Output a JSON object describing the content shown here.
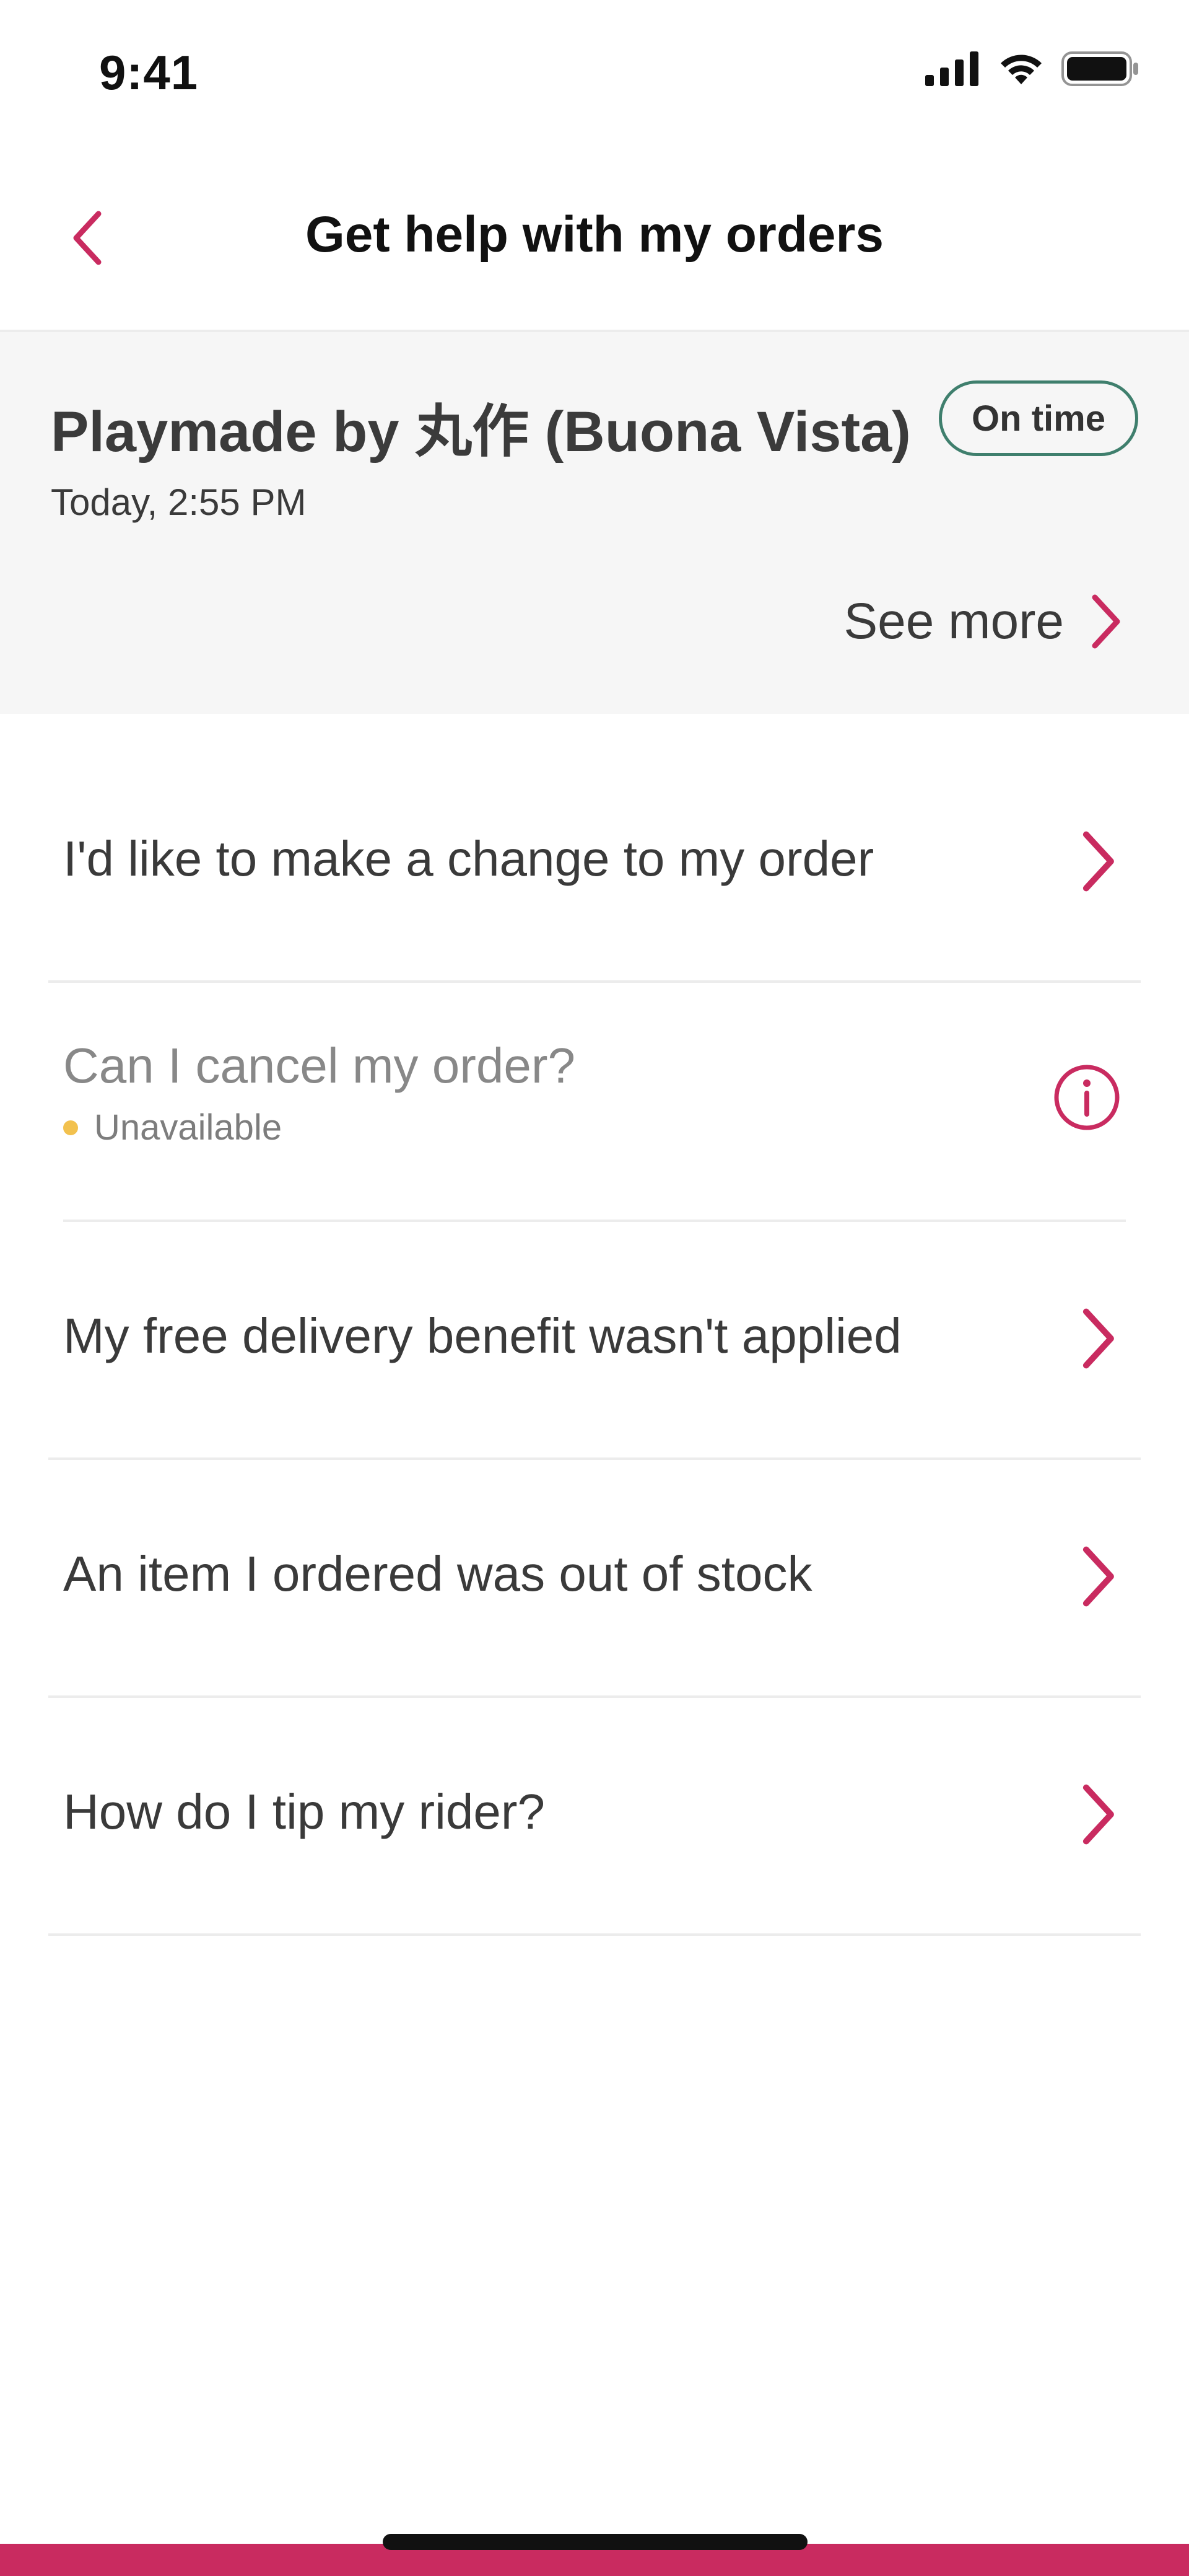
{
  "status_bar": {
    "time": "9:41",
    "icons": [
      "signal-icon",
      "wifi-icon",
      "battery-icon"
    ]
  },
  "nav": {
    "title": "Get help with my orders",
    "back_icon": "chevron-left-icon"
  },
  "order": {
    "restaurant": "Playmade by 丸作 (Buona Vista)",
    "status": "On time",
    "time": "Today, 2:55 PM",
    "see_more": "See more"
  },
  "help_items": [
    {
      "label": "I'd like to make a change to my order",
      "icon": "chevron-right-icon"
    },
    {
      "label": "Can I cancel my order?",
      "sublabel": "Unavailable",
      "icon": "info-icon",
      "disabled": true
    },
    {
      "label": "My free delivery benefit wasn't applied",
      "icon": "chevron-right-icon"
    },
    {
      "label": "An item I ordered was out of stock",
      "icon": "chevron-right-icon"
    },
    {
      "label": "How do I tip my rider?",
      "icon": "chevron-right-icon"
    }
  ],
  "colors": {
    "accent": "#c92b60",
    "badge_border": "#3f7f6d",
    "unavailable_dot": "#f2c14e",
    "card_bg": "#f6f6f6"
  }
}
